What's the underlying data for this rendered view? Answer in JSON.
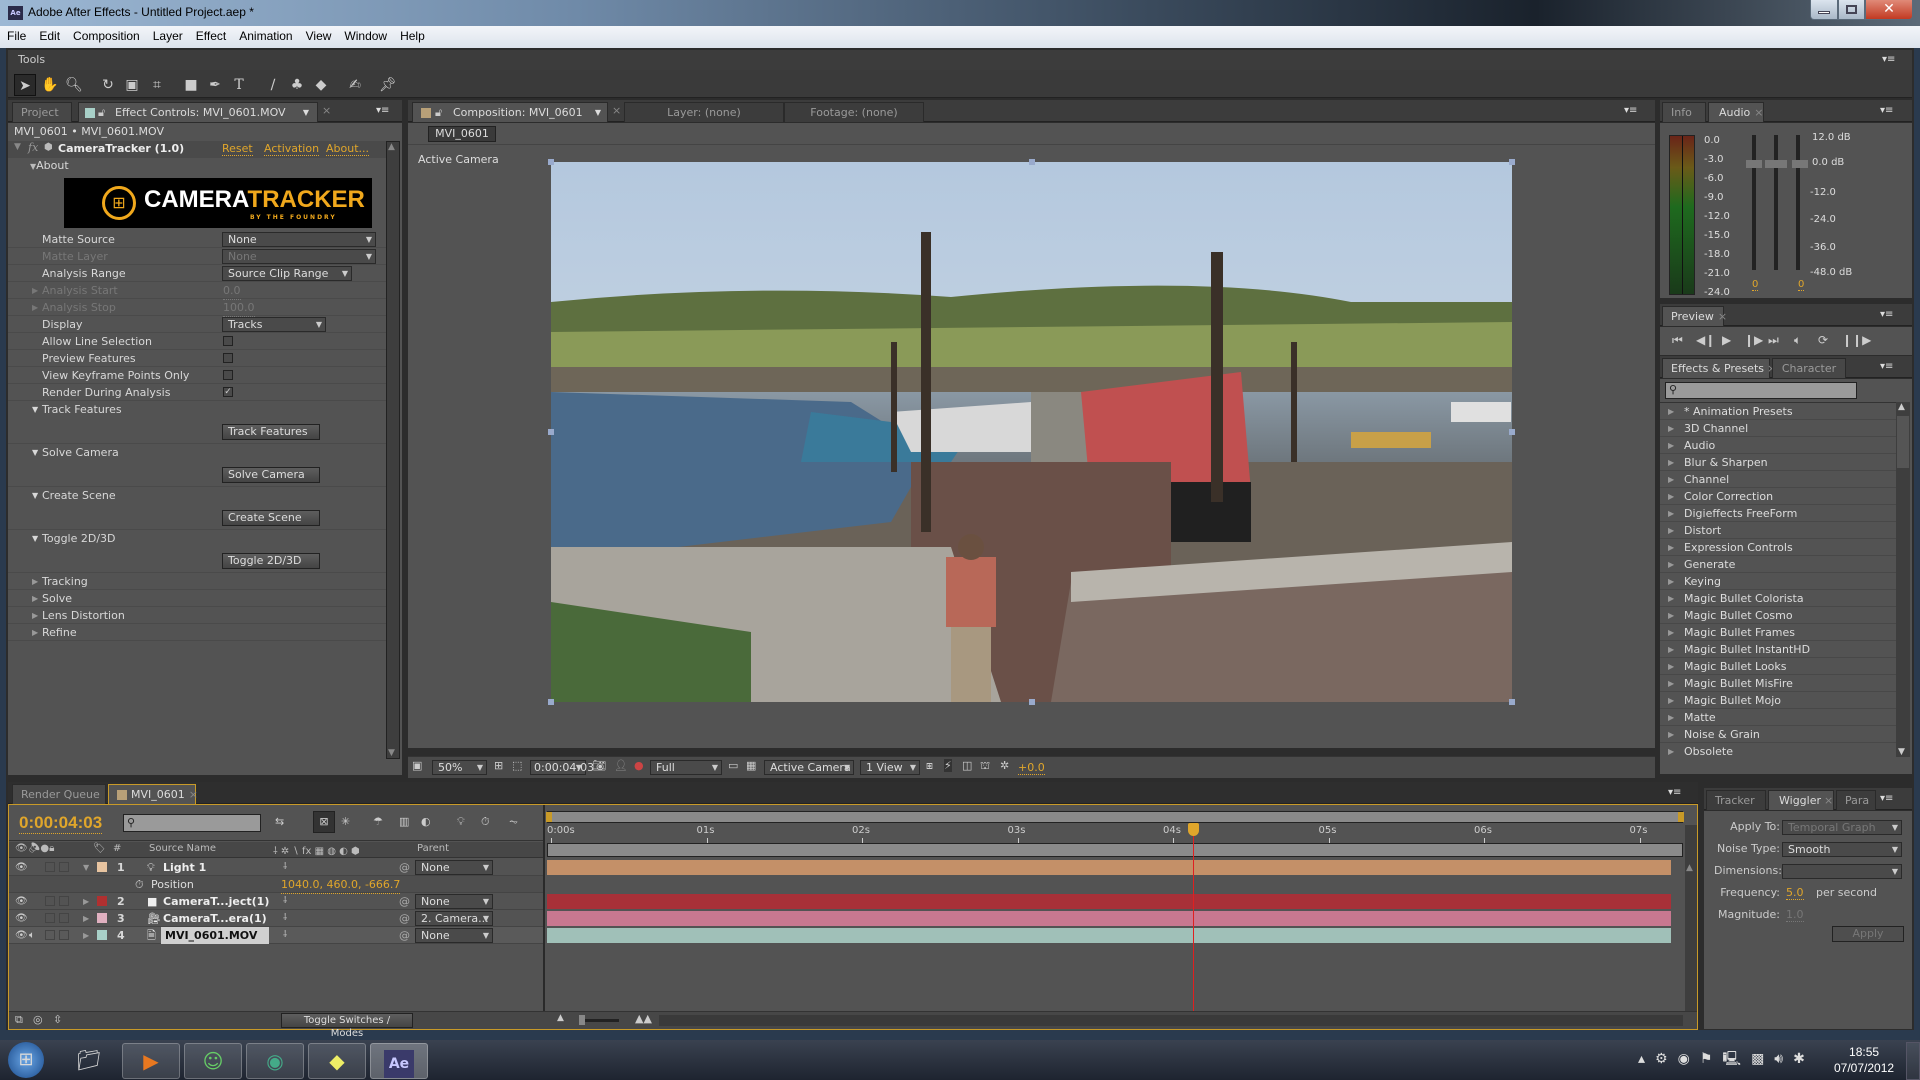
{
  "window": {
    "title": "Adobe After Effects - Untitled Project.aep *",
    "app_icon": "Ae"
  },
  "menu": [
    "File",
    "Edit",
    "Composition",
    "Layer",
    "Effect",
    "Animation",
    "View",
    "Window",
    "Help"
  ],
  "tools": {
    "panel_label": "Tools",
    "items": [
      "selection-tool",
      "hand-tool",
      "zoom-tool",
      "rotation-tool",
      "camera-tool",
      "pan-behind-tool",
      "rectangle-tool",
      "pen-tool",
      "type-tool",
      "brush-tool",
      "clone-stamp-tool",
      "eraser-tool",
      "roto-brush-tool",
      "puppet-pin-tool"
    ]
  },
  "left_panel": {
    "tabs": [
      "Project",
      "Effect Controls: MVI_0601.MOV"
    ],
    "breadcrumb": "MVI_0601 • MVI_0601.MOV",
    "effect_name": "CameraTracker (1.0)",
    "links": {
      "reset": "Reset",
      "activation": "Activation",
      "about": "About..."
    },
    "about_label": "About",
    "logo": {
      "camera": "CAMERA",
      "tracker": "TRACKER",
      "sub": "BY THE FOUNDRY"
    },
    "params": [
      {
        "label": "Matte Source",
        "value": "None",
        "type": "dropdown",
        "enabled": true
      },
      {
        "label": "Matte Layer",
        "value": "None",
        "type": "dropdown",
        "enabled": false
      },
      {
        "label": "Analysis Range",
        "value": "Source Clip Range",
        "type": "dropdown",
        "enabled": true
      },
      {
        "label": "Analysis Start",
        "value": "0.0",
        "type": "number",
        "enabled": false
      },
      {
        "label": "Analysis Stop",
        "value": "100.0",
        "type": "number",
        "enabled": false
      },
      {
        "label": "Display",
        "value": "Tracks",
        "type": "dropdown",
        "enabled": true
      },
      {
        "label": "Allow Line Selection",
        "checked": false,
        "type": "checkbox"
      },
      {
        "label": "Preview Features",
        "checked": false,
        "type": "checkbox"
      },
      {
        "label": "View Keyframe Points Only",
        "checked": false,
        "type": "checkbox"
      },
      {
        "label": "Render During Analysis",
        "checked": true,
        "type": "checkbox"
      }
    ],
    "groups": [
      {
        "label": "Track Features",
        "button": "Track Features"
      },
      {
        "label": "Solve Camera",
        "button": "Solve Camera"
      },
      {
        "label": "Create Scene",
        "button": "Create Scene"
      },
      {
        "label": "Toggle 2D/3D",
        "button": "Toggle 2D/3D"
      }
    ],
    "collapsed": [
      "Tracking",
      "Solve",
      "Lens Distortion",
      "Refine"
    ]
  },
  "comp_panel": {
    "tabs": [
      "Composition: MVI_0601",
      "Layer: (none)",
      "Footage: (none)"
    ],
    "comp_button": "MVI_0601",
    "view_label": "Active Camera",
    "footer": {
      "zoom": "50%",
      "timecode": "0:00:04:03",
      "resolution": "Full",
      "camera": "Active Camera",
      "views": "1 View",
      "exposure": "+0.0"
    }
  },
  "info_audio": {
    "tabs": [
      "Info",
      "Audio"
    ],
    "left_scale": [
      "0.0",
      "-3.0",
      "-6.0",
      "-9.0",
      "-12.0",
      "-15.0",
      "-18.0",
      "-21.0",
      "-24.0"
    ],
    "right_scale": [
      "12.0 dB",
      "0.0 dB",
      "-12.0",
      "-24.0",
      "-36.0",
      "-48.0 dB"
    ],
    "left_value": "0",
    "right_value": "0"
  },
  "preview": {
    "tab": "Preview",
    "controls": [
      "first-frame",
      "prev-frame",
      "play",
      "next-frame",
      "last-frame",
      "audio",
      "loop",
      "ram-preview"
    ]
  },
  "effects_presets": {
    "tabs": [
      "Effects & Presets",
      "Character"
    ],
    "search_placeholder": "",
    "items": [
      "* Animation Presets",
      "3D Channel",
      "Audio",
      "Blur & Sharpen",
      "Channel",
      "Color Correction",
      "Digieffects FreeForm",
      "Distort",
      "Expression Controls",
      "Generate",
      "Keying",
      "Magic Bullet Colorista",
      "Magic Bullet Cosmo",
      "Magic Bullet Frames",
      "Magic Bullet InstantHD",
      "Magic Bullet Looks",
      "Magic Bullet MisFire",
      "Magic Bullet Mojo",
      "Matte",
      "Noise & Grain",
      "Obsolete"
    ]
  },
  "wiggler": {
    "tabs": [
      "Tracker",
      "Wiggler",
      "Para"
    ],
    "apply_to_label": "Apply To:",
    "apply_to": "Temporal Graph",
    "noise_type_label": "Noise Type:",
    "noise_type": "Smooth",
    "dimensions_label": "Dimensions:",
    "dimensions": "",
    "frequency_label": "Frequency:",
    "frequency": "5.0",
    "frequency_unit": "per second",
    "magnitude_label": "Magnitude:",
    "magnitude": "1.0",
    "apply": "Apply"
  },
  "timeline": {
    "tabs": [
      "Render Queue",
      "MVI_0601"
    ],
    "timecode": "0:00:04:03",
    "columns": {
      "source_name": "Source Name",
      "parent": "Parent",
      "number": "#"
    },
    "ruler": [
      "0:00s",
      "01s",
      "02s",
      "03s",
      "04s",
      "05s",
      "06s",
      "07s"
    ],
    "playhead_seconds": 4.13,
    "layers": [
      {
        "num": "1",
        "name": "Light 1",
        "color": "#e8c4a0",
        "bar": "#c49068",
        "parent": "None",
        "expanded": true,
        "icon": "light-icon"
      },
      {
        "num": "2",
        "name": "CameraT...ject(1)",
        "color": "#b03030",
        "bar": "#a83038",
        "parent": "None",
        "icon": "solid-icon"
      },
      {
        "num": "3",
        "name": "CameraT...era(1)",
        "color": "#e0b0c0",
        "bar": "#c87890",
        "parent": "2. Camera...",
        "icon": "camera-icon"
      },
      {
        "num": "4",
        "name": "MVI_0601.MOV",
        "color": "#a8d0c8",
        "bar": "#a0c0b8",
        "parent": "None",
        "icon": "footage-icon"
      }
    ],
    "position": {
      "label": "Position",
      "value": "1040.0, 460.0, -666.7"
    },
    "toggle_label": "Toggle Switches / Modes"
  },
  "taskbar": {
    "time": "18:55",
    "date": "07/07/2012",
    "apps": [
      "start",
      "explorer",
      "media-player",
      "messenger",
      "chrome",
      "sticky-notes",
      "after-effects"
    ]
  }
}
